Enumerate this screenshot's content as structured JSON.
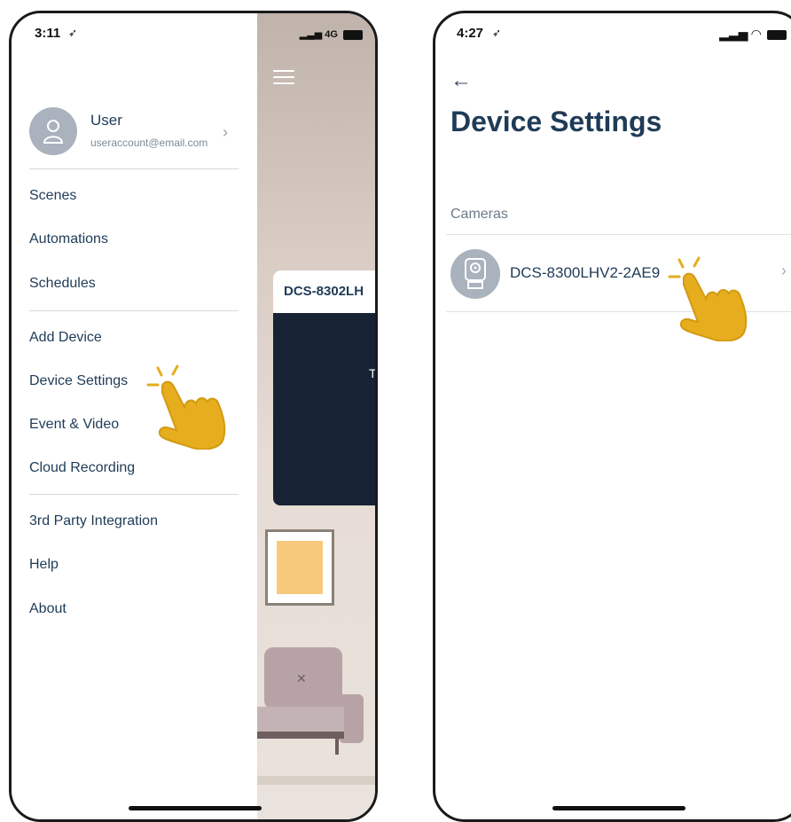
{
  "left_screen": {
    "status": {
      "time": "3:11",
      "signal_label": "4G"
    },
    "drawer": {
      "user": {
        "name": "User",
        "email": "useraccount@email.com"
      },
      "menu_items": [
        {
          "label": "Scenes"
        },
        {
          "label": "Automations"
        },
        {
          "label": "Schedules"
        },
        {
          "label": "Add Device"
        },
        {
          "label": "Device Settings"
        },
        {
          "label": "Event & Video"
        },
        {
          "label": "Cloud Recording"
        },
        {
          "label": "3rd Party Integration"
        },
        {
          "label": "Help"
        },
        {
          "label": "About"
        }
      ]
    },
    "background_app": {
      "camera_card_title": "DCS-8302LH",
      "camera_card_text": "T"
    }
  },
  "right_screen": {
    "status": {
      "time": "4:27"
    },
    "title": "Device Settings",
    "section": "Cameras",
    "devices": [
      {
        "name": "DCS-8300LHV2-2AE9"
      }
    ]
  },
  "colors": {
    "text_primary": "#1f3b57",
    "text_secondary": "#7d8a99",
    "avatar_gray": "#aab2bd",
    "pointer_yellow": "#e6ad1e",
    "card_dark": "#172334"
  },
  "icons": {
    "back": "arrow-left-icon",
    "chevron": "chevron-right-icon",
    "pointer": "pointing-hand-icon",
    "camera": "camera-icon",
    "user": "user-icon",
    "menu": "hamburger-icon"
  }
}
